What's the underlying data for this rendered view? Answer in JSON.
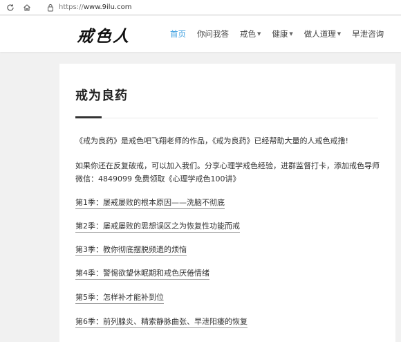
{
  "browser": {
    "url_scheme": "https://",
    "url_host": "www.9ilu.com"
  },
  "site": {
    "logo_text": "戒色人",
    "menu": [
      {
        "label": "首页",
        "active": true,
        "has_dropdown": false
      },
      {
        "label": "你问我答",
        "active": false,
        "has_dropdown": false
      },
      {
        "label": "戒色",
        "active": false,
        "has_dropdown": true
      },
      {
        "label": "健康",
        "active": false,
        "has_dropdown": true
      },
      {
        "label": "做人道理",
        "active": false,
        "has_dropdown": true
      },
      {
        "label": "早泄咨询",
        "active": false,
        "has_dropdown": false
      }
    ],
    "accent_color": "#3ea0e0"
  },
  "post": {
    "title": "戒为良药",
    "intro": "《戒为良药》是戒色吧飞翔老师的作品，《戒为良药》已经帮助大量的人戒色戒撸!",
    "contact": "如果你还在反复破戒，可以加入我们。分享心理学戒色经验，进群监督打卡，添加戒色导师微信：4849099 免费领取《心理学戒色100讲》",
    "seasons": [
      "第1季：屡戒屡败的根本原因——洗脑不彻底",
      "第2季：屡戒屡败的思想误区之为恢复性功能而戒",
      "第3季：教你彻底摆脱频遗的烦恼",
      "第4季：警惕欲望休眠期和戒色厌倦情绪",
      "第5季：怎样补才能补到位",
      "第6季：前列腺炎、精索静脉曲张、早泄阳痿的恢复"
    ]
  }
}
